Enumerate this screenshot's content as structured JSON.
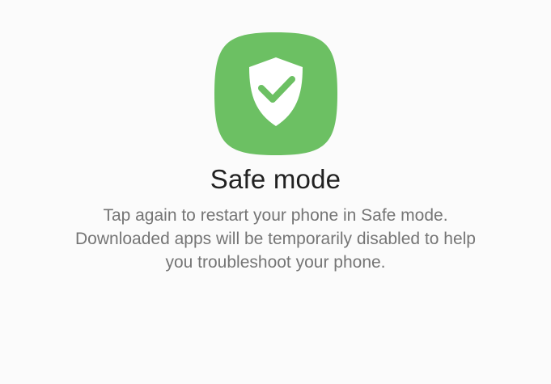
{
  "dialog": {
    "title": "Safe mode",
    "message_lines": [
      "Tap again to restart your phone in Safe mode.",
      "Downloaded apps will be temporarily disabled to help",
      "you troubleshoot your phone."
    ],
    "icon": "shield-check-icon"
  },
  "colors": {
    "background": "#fbfbfb",
    "icon_background": "#6cc063",
    "icon_foreground": "#ffffff",
    "title": "#212121",
    "message": "#757575"
  }
}
